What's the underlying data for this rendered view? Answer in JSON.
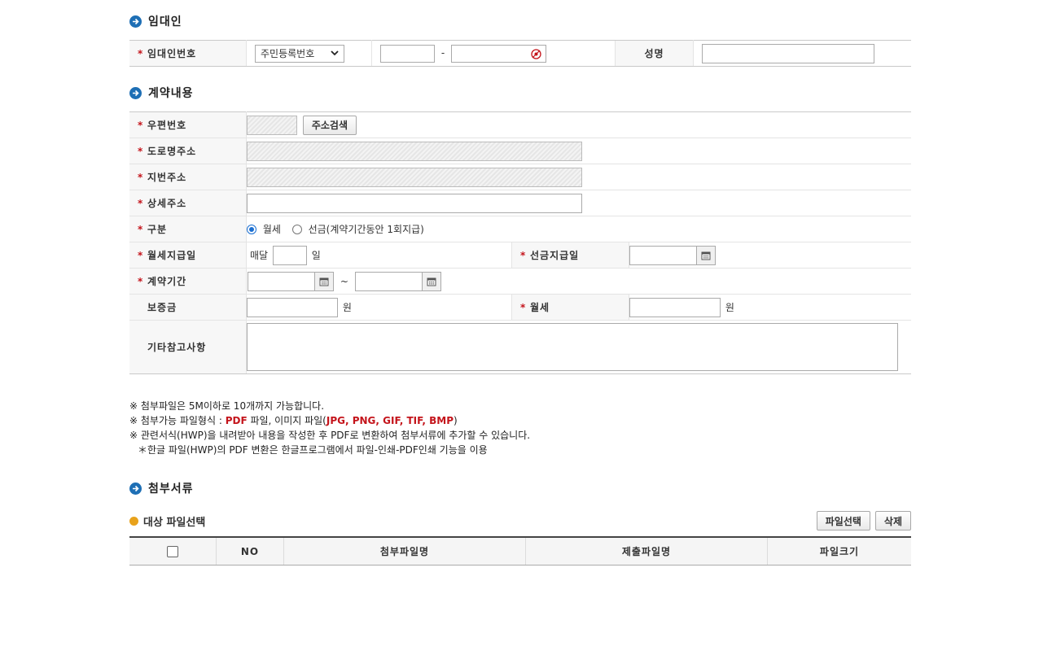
{
  "lessor_section": {
    "title": "임대인",
    "id_label": "임대인번호",
    "id_type_selected": "주민등록번호",
    "name_label": "성명"
  },
  "contract_section": {
    "title": "계약내용",
    "postal_label": "우편번호",
    "address_search_button": "주소검색",
    "road_address_label": "도로명주소",
    "lot_address_label": "지번주소",
    "detail_address_label": "상세주소",
    "type_label": "구분",
    "type_option_monthly": "월세",
    "type_option_prepaid": "선금(계약기간동안 1회지급)",
    "monthly_payday_label": "월세지급일",
    "every_month": "매달",
    "day_unit": "일",
    "prepaid_date_label": "선금지급일",
    "period_label": "계약기간",
    "period_sep": "~",
    "deposit_label": "보증금",
    "won_unit": "원",
    "monthly_rent_label": "월세",
    "notes_label": "기타참고사항"
  },
  "notes": {
    "line1": "※ 첨부파일은 5M이하로 10개까지 가능합니다.",
    "line2_prefix": "※ 첨부가능 파일형식 : ",
    "line2_pdf": "PDF",
    "line2_mid": " 파일, 이미지 파일(",
    "line2_images": "JPG, PNG, GIF, TIF, BMP",
    "line2_suffix": ")",
    "line3": "※ 관련서식(HWP)을 내려받아 내용을 작성한 후 PDF로 변환하여 첨부서류에 추가할 수 있습니다.",
    "line4": "＊한글 파일(HWP)의 PDF 변환은 한글프로그램에서 파일-인쇄-PDF인쇄 기능을 이용"
  },
  "attach_section": {
    "title": "첨부서류",
    "sub_title": "대상 파일선택",
    "select_file_button": "파일선택",
    "delete_button": "삭제",
    "columns": [
      "NO",
      "첨부파일명",
      "제출파일명",
      "파일크기"
    ]
  },
  "required_mark": "*",
  "colors": {
    "accent_blue": "#1e6fb5",
    "required_red": "#c4141b",
    "sub_icon": "#e8a21b"
  }
}
